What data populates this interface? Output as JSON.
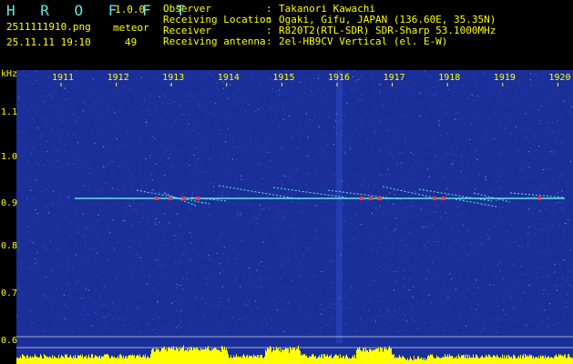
{
  "app": {
    "title": "H R O F F T",
    "version": "1.0.0"
  },
  "file": {
    "name": "2511111910.png",
    "datetime": "25.11.11 19:10"
  },
  "detection": {
    "label": "meteor",
    "count": "49"
  },
  "info": {
    "observer": {
      "label": "Observer",
      "value": "Takanori Kawachi"
    },
    "location": {
      "label": "Receiving Location",
      "value": "Ogaki, Gifu, JAPAN (136.60E, 35.35N)"
    },
    "receiver": {
      "label": "Receiver",
      "value": "R820T2(RTL-SDR) SDR-Sharp 53.1000MHz"
    },
    "antenna": {
      "label": "Receiving antenna",
      "value": "2el-HB9CV Vertical (el. E-W)"
    },
    "separator": ":"
  },
  "spectrogram": {
    "unit": "kHz",
    "y_ticks": [
      "1.1",
      "1.0",
      "0.9",
      "0.8",
      "0.7",
      "0.6"
    ],
    "x_ticks": [
      "1911",
      "1912",
      "1913",
      "1914",
      "1915",
      "1916",
      "1917",
      "1918",
      "1919",
      "1920"
    ],
    "colors": {
      "background": "#1a2f9a",
      "noise": "#5566d8",
      "trace": "#63e5df",
      "hot": "#ff3a3a",
      "level": "#ffff00",
      "text": "#ffff00"
    }
  }
}
